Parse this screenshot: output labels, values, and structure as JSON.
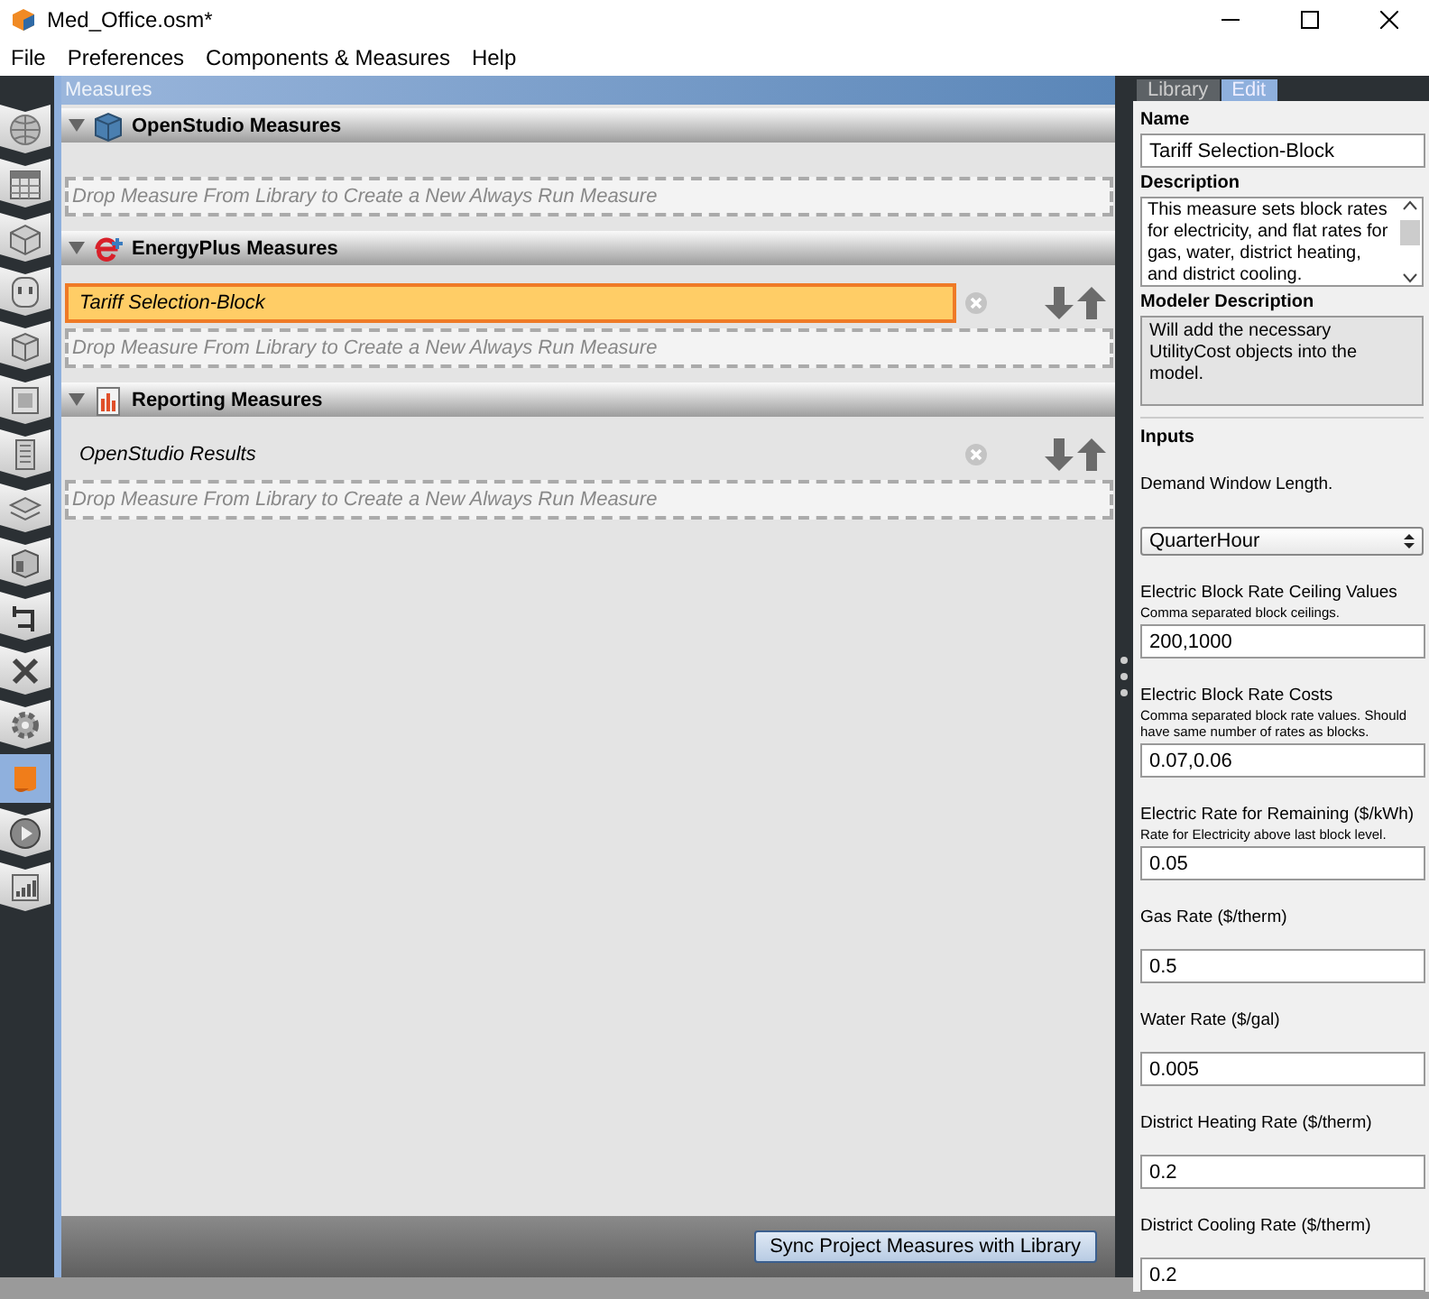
{
  "window": {
    "title": "Med_Office.osm*"
  },
  "menu": [
    "File",
    "Preferences",
    "Components & Measures",
    "Help"
  ],
  "nav": [
    {
      "selected": false
    },
    {
      "selected": false
    },
    {
      "selected": false
    },
    {
      "selected": false
    },
    {
      "selected": false
    },
    {
      "selected": false
    },
    {
      "selected": false
    },
    {
      "selected": false
    },
    {
      "selected": false
    },
    {
      "selected": false
    },
    {
      "selected": false
    },
    {
      "selected": false
    },
    {
      "selected": true
    },
    {
      "selected": false
    },
    {
      "selected": false
    }
  ],
  "measures": {
    "title": "Measures",
    "groups": [
      {
        "title": "OpenStudio Measures",
        "kind": "openstudio",
        "expanded": true,
        "drop_hint": "Drop Measure From Library to Create a New Always Run Measure"
      },
      {
        "title": "EnergyPlus Measures",
        "kind": "energyplus",
        "expanded": true,
        "measures": [
          {
            "name": "Tariff Selection-Block",
            "selected": true
          }
        ],
        "drop_hint": "Drop Measure From Library to Create a New Always Run Measure"
      },
      {
        "title": "Reporting Measures",
        "kind": "reporting",
        "expanded": true,
        "measures": [
          {
            "name": "OpenStudio Results",
            "selected": false
          }
        ],
        "drop_hint": "Drop Measure From Library to Create a New Always Run Measure"
      }
    ],
    "sync_button": "Sync Project Measures with Library"
  },
  "inspector": {
    "tabs": [
      {
        "label": "Library",
        "selected": false
      },
      {
        "label": "Edit",
        "selected": true
      }
    ],
    "name_label": "Name",
    "name": "Tariff Selection-Block",
    "description_label": "Description",
    "description": "This measure sets block rates for electricity, and flat rates for gas, water, district heating, and district cooling.",
    "modeler_description_label": "Modeler Description",
    "modeler_description": "Will add the necessary UtilityCost objects into the model.",
    "inputs_label": "Inputs",
    "inputs": [
      {
        "kind": "choice",
        "label": "Demand Window Length.",
        "value": "QuarterHour"
      },
      {
        "kind": "text",
        "label": "Electric Block Rate Ceiling Values",
        "hint": "Comma separated block ceilings.",
        "value": "200,1000"
      },
      {
        "kind": "text",
        "label": "Electric Block Rate Costs",
        "hint": "Comma separated block rate values. Should have same number of rates as blocks.",
        "value": "0.07,0.06"
      },
      {
        "kind": "text",
        "label": "Electric Rate for Remaining ($/kWh)",
        "hint": "Rate for Electricity above last block level.",
        "value": "0.05"
      },
      {
        "kind": "text",
        "label": "Gas Rate ($/therm)",
        "value": "0.5"
      },
      {
        "kind": "text",
        "label": "Water Rate ($/gal)",
        "value": "0.005"
      },
      {
        "kind": "text",
        "label": "District Heating Rate ($/therm)",
        "value": "0.2"
      },
      {
        "kind": "text",
        "label": "District Cooling Rate ($/therm)",
        "value": "0.2"
      }
    ]
  }
}
